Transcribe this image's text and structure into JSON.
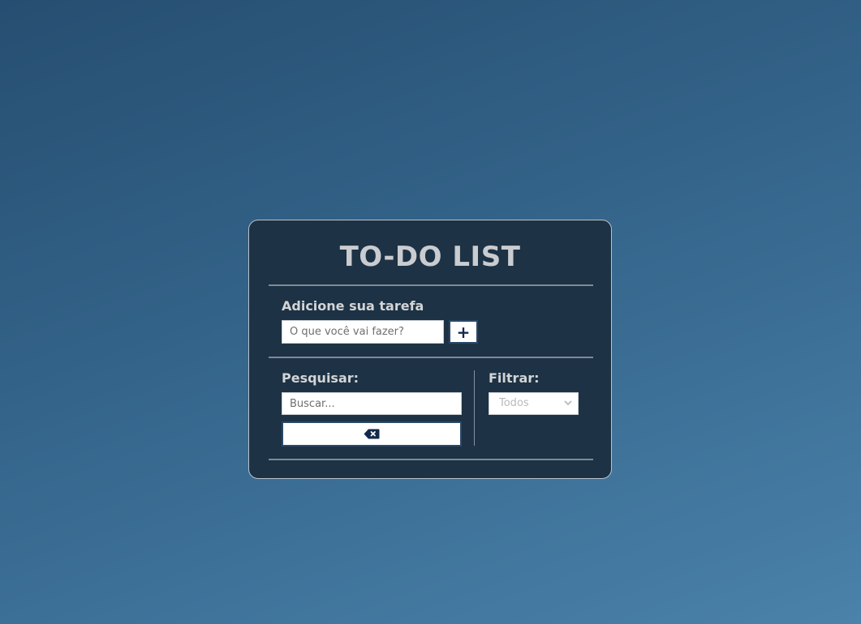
{
  "app": {
    "title": "TO-DO LIST"
  },
  "add_section": {
    "label": "Adicione sua tarefa",
    "input_placeholder": "O que você vai fazer?",
    "input_value": "",
    "add_button_label": "+"
  },
  "search_section": {
    "label": "Pesquisar:",
    "input_placeholder": "Buscar...",
    "input_value": "",
    "clear_button_icon": "backspace-icon"
  },
  "filter_section": {
    "label": "Filtrar:",
    "selected_option": "Todos"
  },
  "colors": {
    "card_background": "#1d3244",
    "accent": "#13294b",
    "text_light": "#d2d4d6"
  }
}
